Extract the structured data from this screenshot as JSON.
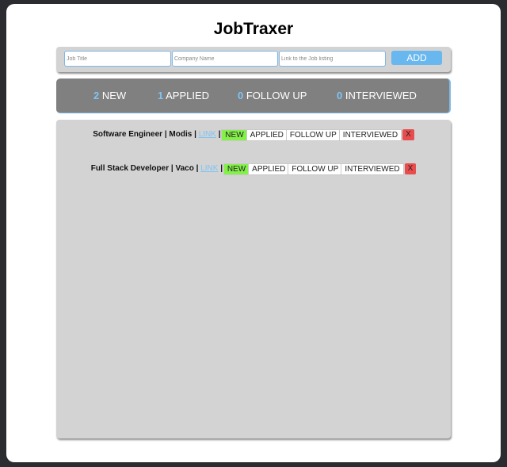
{
  "app": {
    "title": "JobTraxer"
  },
  "form": {
    "job_title_placeholder": "Job Title",
    "company_placeholder": "Company Name",
    "link_placeholder": "Link to the Job listing",
    "add_label": "ADD"
  },
  "stats": [
    {
      "count": "2",
      "label": "NEW"
    },
    {
      "count": "1",
      "label": "APPLIED"
    },
    {
      "count": "0",
      "label": "FOLLOW UP"
    },
    {
      "count": "0",
      "label": "INTERVIEWED"
    }
  ],
  "jobs": [
    {
      "title": "Software Engineer",
      "company": "Modis",
      "link_label": "LINK",
      "status": "NEW",
      "statuses": [
        "NEW",
        "APPLIED",
        "FOLLOW UP",
        "INTERVIEWED"
      ],
      "delete_label": "X"
    },
    {
      "title": "Full Stack Developer",
      "company": "Vaco",
      "link_label": "LINK",
      "status": "NEW",
      "statuses": [
        "NEW",
        "APPLIED",
        "FOLLOW UP",
        "INTERVIEWED"
      ],
      "delete_label": "X"
    }
  ],
  "separator": "|",
  "colors": {
    "accent": "#68b7ee",
    "count_blue": "#7fc4f5",
    "active_status": "#84f04a",
    "delete": "#e84c4c",
    "panel_gray": "#d3d3d3",
    "stats_gray": "#808080"
  }
}
